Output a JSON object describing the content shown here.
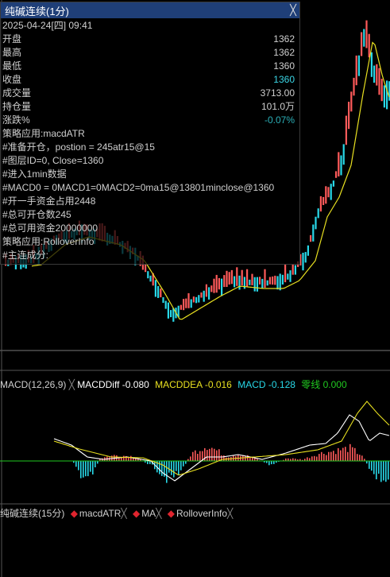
{
  "info_panel": {
    "title": "纯碱连续(1分)",
    "datetime": "2025-04-24[四] 09:41",
    "rows": [
      {
        "label": "开盘",
        "value": "1362"
      },
      {
        "label": "最高",
        "value": "1362"
      },
      {
        "label": "最低",
        "value": "1360"
      },
      {
        "label": "收盘",
        "value": "1360"
      },
      {
        "label": "成交量",
        "value": "3713.00"
      },
      {
        "label": "持仓量",
        "value": "101.0万"
      },
      {
        "label": "涨跌%",
        "value": "-0.07%"
      }
    ],
    "log_lines": [
      "策略应用:macdATR",
      "#准备开仓，postion = 245atr15@15",
      "#图层ID=0, Close=1360",
      "#进入1min数据",
      "#MACD0 = 0MACD1=0MACD2=0ma15@13801minclose@1360",
      "#开一手资金占用2448",
      "#总可开仓数245",
      "#总可用资金20000000",
      "策略应用:RolloverInfo",
      "#主连成分:"
    ]
  },
  "macd_legend": {
    "indicator": "MACD(12,26,9)",
    "close_glyph": "╳",
    "diff_label": "MACDDiff",
    "diff_value": "-0.080",
    "dea_label": "MACDDEA",
    "dea_value": "-0.016",
    "macd_label": "MACD",
    "macd_value": "-0.128",
    "zero_label": "零线",
    "zero_value": "0.000"
  },
  "bottom_tabs": {
    "source": "纯碱连续(15分)",
    "items": [
      "macdATR",
      "MA",
      "RolloverInfo"
    ],
    "close_glyph": "╳"
  },
  "colors": {
    "up": "#ff5a5a",
    "down": "#28d8e8",
    "ma_line": "#e8e020",
    "diff_line": "#ffffff",
    "dea_line": "#e8e020",
    "zero_line": "#20c820",
    "title_bar": "#1f3f78",
    "bullet": "#e0242e"
  }
}
